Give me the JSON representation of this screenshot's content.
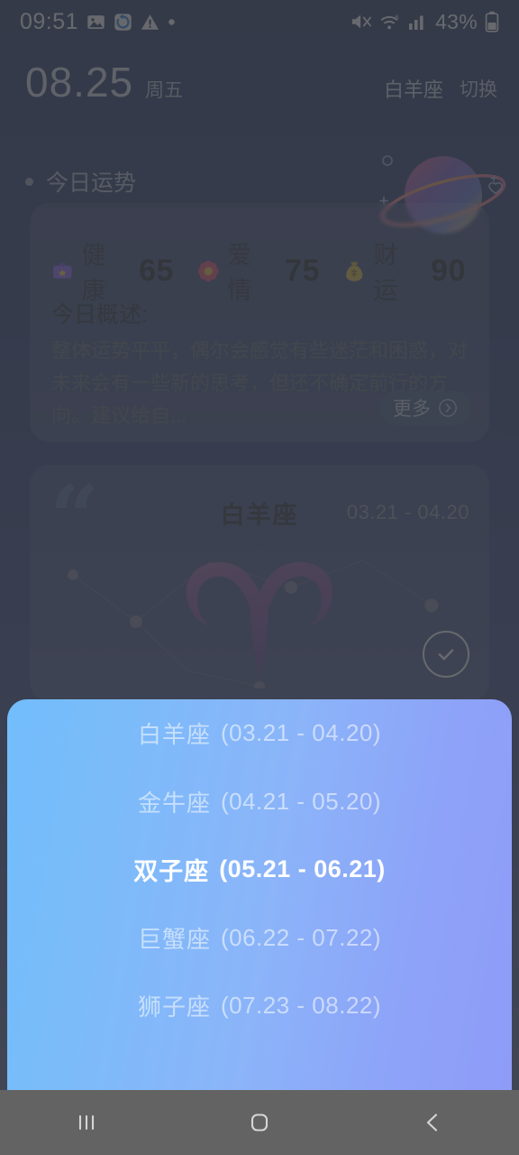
{
  "status_bar": {
    "time": "09:51",
    "left_icons": [
      "image-icon",
      "sync-icon",
      "warning-icon",
      "dot-icon"
    ],
    "right_icons": [
      "mute-icon",
      "wifi-icon",
      "signal-icon",
      "battery-icon"
    ],
    "battery_percent": "43%"
  },
  "header": {
    "date": "08.25",
    "weekday": "周五",
    "current_sign": "白羊座",
    "switch_label": "切换"
  },
  "section": {
    "today_fortune_label": "今日运势"
  },
  "fortune_card": {
    "scores": [
      {
        "emoji": "health-kit-icon",
        "label": "健康",
        "value": "65"
      },
      {
        "emoji": "flower-icon",
        "label": "爱情",
        "value": "75"
      },
      {
        "emoji": "money-bag-icon",
        "label": "财运",
        "value": "90"
      }
    ],
    "summary_title": "今日概述:",
    "summary_text": "整体运势平平，偶尔会感觉有些迷茫和困惑，对未来会有一些新的思考，但还不确定前行的方向。建议给自...",
    "more_label": "更多"
  },
  "sign_card": {
    "title": "白羊座",
    "date_range": "03.21 - 04.20",
    "symbol": "aries-symbol",
    "confirm_icon": "check-circle-icon"
  },
  "picker": {
    "items": [
      {
        "name": "白羊座",
        "range": "(03.21 - 04.20)",
        "selected": false
      },
      {
        "name": "金牛座",
        "range": "(04.21 - 05.20)",
        "selected": false
      },
      {
        "name": "双子座",
        "range": "(05.21 - 06.21)",
        "selected": true
      },
      {
        "name": "巨蟹座",
        "range": "(06.22 - 07.22)",
        "selected": false
      },
      {
        "name": "狮子座",
        "range": "(07.23 - 08.22)",
        "selected": false
      }
    ]
  },
  "nav_bar": {
    "buttons": [
      "recents-icon",
      "home-icon",
      "back-icon"
    ]
  },
  "colors": {
    "accent_blue": "#3b5680",
    "sheet_start": "#72bdfb",
    "sheet_end": "#8e9cf8",
    "nav_bg": "#636363",
    "scrim": "rgba(60,63,68,0.78)"
  }
}
